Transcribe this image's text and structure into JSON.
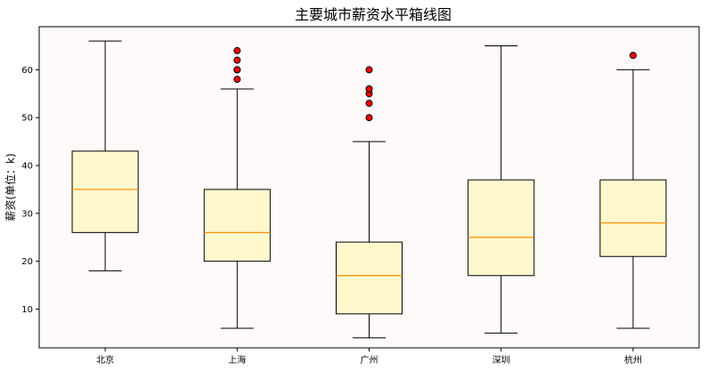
{
  "chart_data": {
    "type": "box",
    "title": "主要城市薪资水平箱线图",
    "ylabel": "薪资(单位：k)",
    "xlabel": "",
    "categories": [
      "北京",
      "上海",
      "广州",
      "深圳",
      "杭州"
    ],
    "yticks": [
      10,
      20,
      30,
      40,
      50,
      60
    ],
    "ylim": [
      1.9,
      69
    ],
    "grid": false,
    "colors": {
      "plot_bg": "#fffafa",
      "box_fill": "#fff8cd",
      "box_edge": "#000000",
      "median": "#ff8c00",
      "outlier_fill": "#ff0000",
      "outlier_edge": "#000000"
    },
    "series": [
      {
        "category": "北京",
        "whisker_low": 18,
        "q1": 26,
        "median": 35,
        "q3": 43,
        "whisker_high": 66,
        "outliers": []
      },
      {
        "category": "上海",
        "whisker_low": 6,
        "q1": 20,
        "median": 26,
        "q3": 35,
        "whisker_high": 56,
        "outliers": [
          58,
          60,
          60,
          62,
          64
        ]
      },
      {
        "category": "广州",
        "whisker_low": 4,
        "q1": 9,
        "median": 17,
        "q3": 24,
        "whisker_high": 45,
        "outliers": [
          50,
          53,
          55,
          56,
          56,
          60
        ]
      },
      {
        "category": "深圳",
        "whisker_low": 5,
        "q1": 17,
        "median": 25,
        "q3": 37,
        "whisker_high": 65,
        "outliers": []
      },
      {
        "category": "杭州",
        "whisker_low": 6,
        "q1": 21,
        "median": 28,
        "q3": 37,
        "whisker_high": 60,
        "outliers": [
          63
        ]
      }
    ]
  }
}
